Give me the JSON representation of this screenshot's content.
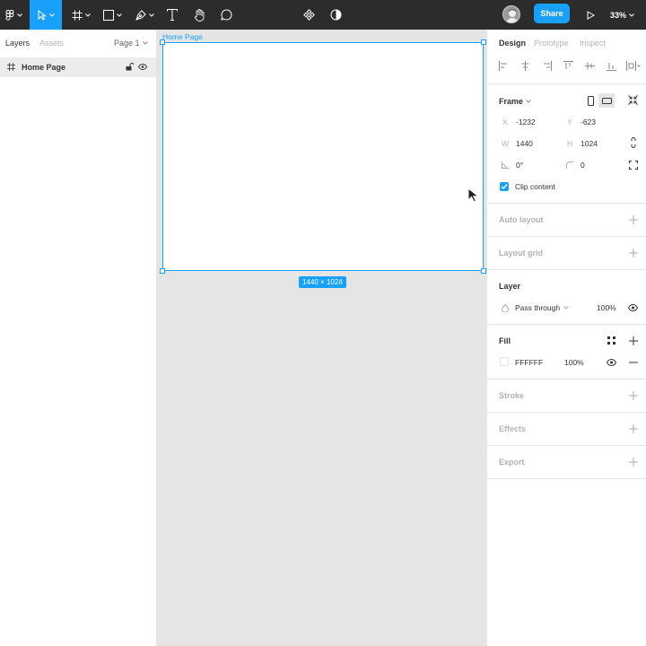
{
  "toolbar": {
    "tools": [
      "main-menu",
      "move",
      "frame",
      "shape",
      "pen",
      "text",
      "hand",
      "comment"
    ],
    "center": [
      "component-icon",
      "contrast-icon"
    ],
    "share_label": "Share",
    "zoom": "33%"
  },
  "left_panel": {
    "tabs": {
      "layers": "Layers",
      "assets": "Assets"
    },
    "page": "Page 1",
    "layers": [
      {
        "name": "Home Page",
        "type": "frame"
      }
    ]
  },
  "canvas": {
    "frame_label": "Home Page",
    "size_badge": "1440 × 1024"
  },
  "right_panel": {
    "tabs": {
      "design": "Design",
      "prototype": "Prototype",
      "inspect": "Inspect"
    },
    "frame": {
      "title": "Frame",
      "x_label": "X",
      "x": "-1232",
      "y_label": "Y",
      "y": "-623",
      "w_label": "W",
      "w": "1440",
      "h_label": "H",
      "h": "1024",
      "rotation": "0°",
      "radius": "0",
      "clip_content": "Clip content"
    },
    "sections": {
      "auto_layout": "Auto layout",
      "layout_grid": "Layout grid",
      "layer": "Layer",
      "fill": "Fill",
      "stroke": "Stroke",
      "effects": "Effects",
      "export": "Export"
    },
    "layer": {
      "blend": "Pass through",
      "opacity": "100%"
    },
    "fill": {
      "hex": "FFFFFF",
      "opacity": "100%",
      "color": "#ffffff"
    }
  },
  "colors": {
    "accent": "#18a0fb",
    "toolbar_bg": "#2c2c2c",
    "canvas_bg": "#e5e5e5"
  }
}
